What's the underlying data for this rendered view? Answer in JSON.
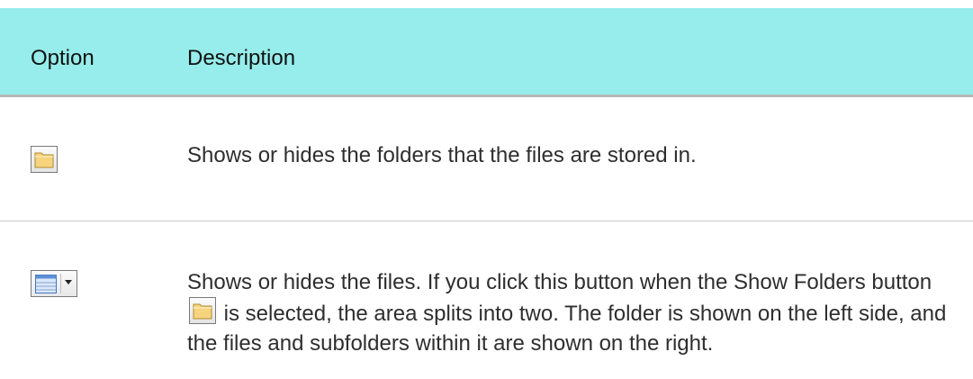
{
  "table": {
    "headers": {
      "option": "Option",
      "description": "Description"
    },
    "rows": [
      {
        "icon": "show-folders-icon",
        "description": "Shows or hides the folders that the files are stored in."
      },
      {
        "icon": "show-files-icon",
        "description_part1": "Shows or hides the files. If you click this button when the Show Folders button",
        "inline_icon": "show-folders-icon",
        "description_part2": "is selected, the area splits into two. The folder is shown on the left side, and the files and subfolders within it are shown on the right."
      }
    ]
  },
  "colors": {
    "header_background": "#96edeb",
    "header_border": "#b5b7b7",
    "row_divider": "#c8c8c8",
    "folder_fill": "#f6d47e"
  }
}
